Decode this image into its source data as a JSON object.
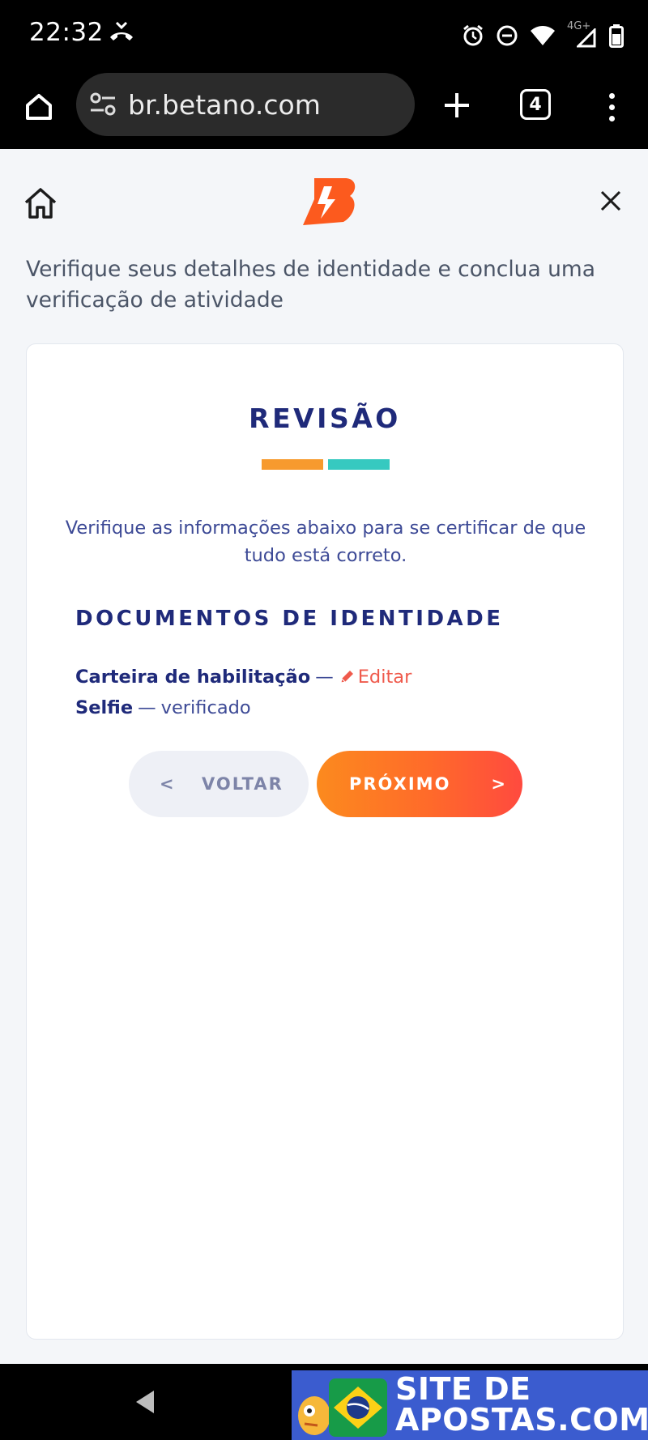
{
  "status_bar": {
    "time": "22:32",
    "network": "4G+"
  },
  "browser": {
    "url": "br.betano.com",
    "tab_count": "4"
  },
  "page": {
    "intro": "Verifique seus detalhes de identidade e conclua uma verificação de atividade",
    "colors": {
      "brand_orange": "#fc5a1e",
      "navy": "#1f2a7a",
      "progress_step_1": "#f79a2e",
      "progress_step_2": "#36c9c0",
      "edit_red": "#ef5a4c"
    }
  },
  "card": {
    "title": "REVISÃO",
    "description": "Verifique as informações abaixo para se certificar de que tudo está correto.",
    "section_title": "DOCUMENTOS DE IDENTIDADE",
    "documents": [
      {
        "name": "Carteira de habilitação",
        "separator": "—",
        "action": "Editar"
      },
      {
        "name": "Selfie",
        "separator": "—",
        "status": "verificado"
      }
    ],
    "back_button": {
      "arrow": "<",
      "label": "VOLTAR"
    },
    "next_button": {
      "label": "PRÓXIMO",
      "arrow": ">"
    }
  },
  "watermark": {
    "line1": "SITE DE",
    "line2": "APOSTAS.COM"
  }
}
